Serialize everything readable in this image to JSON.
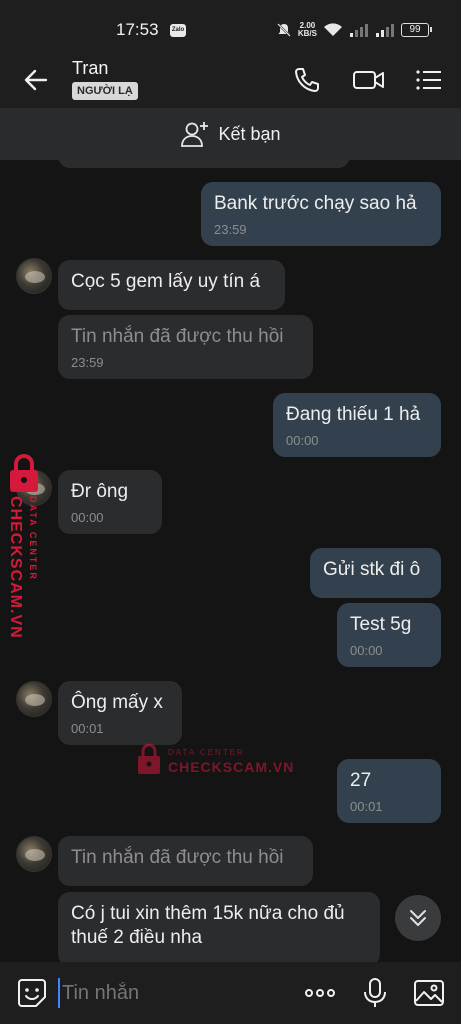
{
  "status_bar": {
    "time": "17:53",
    "app_icon": "zalo-icon",
    "speed_value": "2.00",
    "speed_unit": "KB/S",
    "battery": "99"
  },
  "header": {
    "contact_name": "Tran",
    "stranger_tag": "NGƯỜI LẠ",
    "icons": [
      "back-arrow-icon",
      "phone-icon",
      "video-call-icon",
      "menu-icon"
    ]
  },
  "add_friend": {
    "label": "Kết bạn",
    "icon": "add-person-icon"
  },
  "messages": [
    {
      "side": "out",
      "text": "Bank trước chạy sao hả",
      "time": "23:59"
    },
    {
      "side": "in",
      "text": "Cọc 5 gem lấy uy tín á",
      "time": ""
    },
    {
      "side": "in",
      "text": "Tin nhắn đã được thu hồi",
      "time": "23:59",
      "recalled": true
    },
    {
      "side": "out",
      "text": "Đang thiếu 1 hả",
      "time": "00:00"
    },
    {
      "side": "in",
      "text": "Đr ông",
      "time": "00:00"
    },
    {
      "side": "out",
      "text": "Gửi stk đi ô",
      "time": ""
    },
    {
      "side": "out",
      "text": "Test 5g",
      "time": "00:00"
    },
    {
      "side": "in",
      "text": "Ông mấy x",
      "time": "00:01"
    },
    {
      "side": "out",
      "text": "27",
      "time": "00:01"
    },
    {
      "side": "in",
      "text": "Tin nhắn đã được thu hồi",
      "time": "",
      "recalled": true
    },
    {
      "side": "in",
      "text": "Có j tui xin thêm 15k nữa cho đủ",
      "text2": "thuế 2 điều nha",
      "time": ""
    }
  ],
  "watermark": {
    "side_line1": "DATA CENTER",
    "side_line2": "CHECKSCAM.VN",
    "center_line1": "DATA CENTER",
    "center_line2": "CHECKSCAM.VN",
    "color": "#d4193a"
  },
  "input_bar": {
    "placeholder": "Tin nhắn",
    "icons": [
      "sticker-icon",
      "more-dots-icon",
      "microphone-icon",
      "image-icon"
    ]
  },
  "colors": {
    "background": "#141414",
    "incoming_bubble": "#2b2c2e",
    "outgoing_bubble": "#33414f",
    "cursor": "#3d86ff"
  }
}
